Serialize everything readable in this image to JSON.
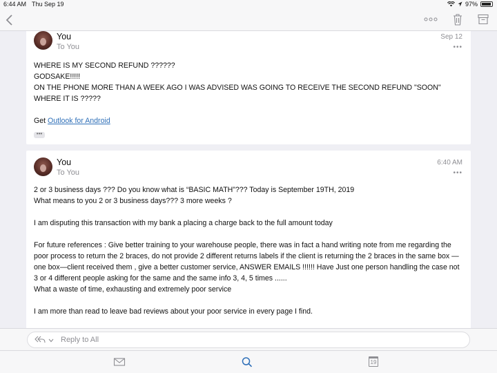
{
  "status_bar": {
    "time": "6:44 AM",
    "date": "Thu Sep 19",
    "battery": "97%"
  },
  "nav": {
    "back_icon": "chevron-left-icon",
    "more_icon": "ellipsis-icon",
    "delete_icon": "trash-icon",
    "archive_icon": "archive-icon"
  },
  "messages": [
    {
      "sender": "You",
      "recipient": "To You",
      "date": "Sep 12",
      "more": "•••",
      "lines": [
        "WHERE IS MY SECOND REFUND ??????",
        "GODSAKE!!!!!",
        "ON THE PHONE MORE THAN A WEEK AGO I WAS ADVISED WAS GOING TO RECEIVE THE SECOND REFUND \"SOON\"",
        "WHERE IT IS ?????"
      ],
      "signature_prefix": "Get ",
      "signature_link": "Outlook for Android",
      "expand": "•••"
    },
    {
      "sender": "You",
      "recipient": "To You",
      "date": "6:40 AM",
      "more": "•••",
      "paragraphs": [
        "2 or 3 business days ??? Do you know what is “BASIC MATH”??? Today is September 19TH, 2019",
        "What means to you 2 or 3 business days??? 3 more weeks ?",
        "I am disputing this transaction with my bank a placing a charge back to the full amount today",
        "For future references : Give better training to your warehouse people, there was in fact a hand writing note from me regarding the poor process to return the 2 braces, do not provide 2 different returns labels if the client is returning the 2 braces in the same box —one box—client received them , give a better customer service, ANSWER EMAILS !!!!!! Have Just one person handling the case not 3 or 4 different people asking for the same and the same info 3, 4, 5 times ......",
        "What a waste of time, exhausting and extremely poor service",
        "I am more than read to leave bad reviews about your poor service in every page I find."
      ]
    }
  ],
  "reply": {
    "label": "Reply to All",
    "icon": "reply-all-icon"
  },
  "tabs": {
    "mail_icon": "mail-icon",
    "search_icon": "search-icon",
    "calendar_icon": "calendar-icon",
    "calendar_day": "19"
  },
  "colors": {
    "accent": "#2e6fb8",
    "muted": "#8e8e93",
    "background": "#efeff4"
  }
}
